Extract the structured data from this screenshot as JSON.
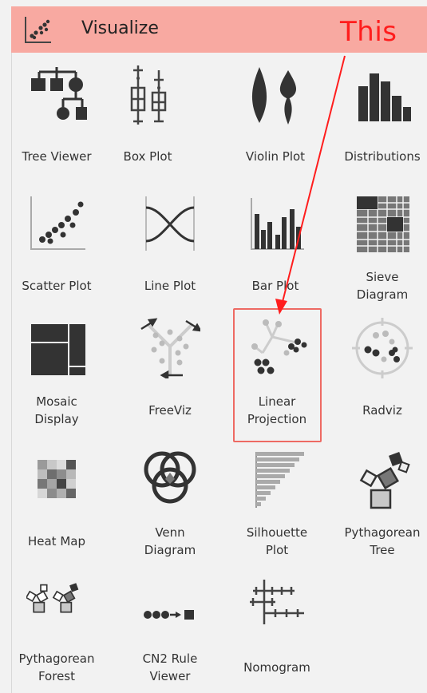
{
  "header": {
    "title": "Visualize",
    "icon": "scatter-plot-icon"
  },
  "annotation": {
    "text": "This",
    "color": "#ff1d1d"
  },
  "tiles": [
    {
      "label": "Tree Viewer",
      "icon": "tree-viewer-icon"
    },
    {
      "label": "Box Plot",
      "icon": "box-plot-icon"
    },
    {
      "label": "Violin Plot",
      "icon": "violin-plot-icon"
    },
    {
      "label": "Distributions",
      "icon": "distributions-icon"
    },
    {
      "label": "Scatter Plot",
      "icon": "scatter-plot-icon"
    },
    {
      "label": "Line Plot",
      "icon": "line-plot-icon"
    },
    {
      "label": "Bar Plot",
      "icon": "bar-plot-icon"
    },
    {
      "label": "Sieve\nDiagram",
      "icon": "sieve-diagram-icon"
    },
    {
      "label": "Mosaic\nDisplay",
      "icon": "mosaic-display-icon"
    },
    {
      "label": "FreeViz",
      "icon": "freeviz-icon"
    },
    {
      "label": "Linear\nProjection",
      "icon": "linear-projection-icon"
    },
    {
      "label": "Radviz",
      "icon": "radviz-icon"
    },
    {
      "label": "Heat Map",
      "icon": "heat-map-icon"
    },
    {
      "label": "Venn\nDiagram",
      "icon": "venn-diagram-icon"
    },
    {
      "label": "Silhouette\nPlot",
      "icon": "silhouette-plot-icon"
    },
    {
      "label": "Pythagorean\nTree",
      "icon": "pythagorean-tree-icon"
    },
    {
      "label": "Pythagorean\nForest",
      "icon": "pythagorean-forest-icon"
    },
    {
      "label": "CN2 Rule\nViewer",
      "icon": "cn2-rule-viewer-icon"
    },
    {
      "label": "Nomogram",
      "icon": "nomogram-icon"
    }
  ],
  "selected_label": "Linear\nProjection",
  "colors": {
    "header": "#f8a9a1",
    "selection_border": "#ee6a63",
    "icon": "#333333"
  }
}
